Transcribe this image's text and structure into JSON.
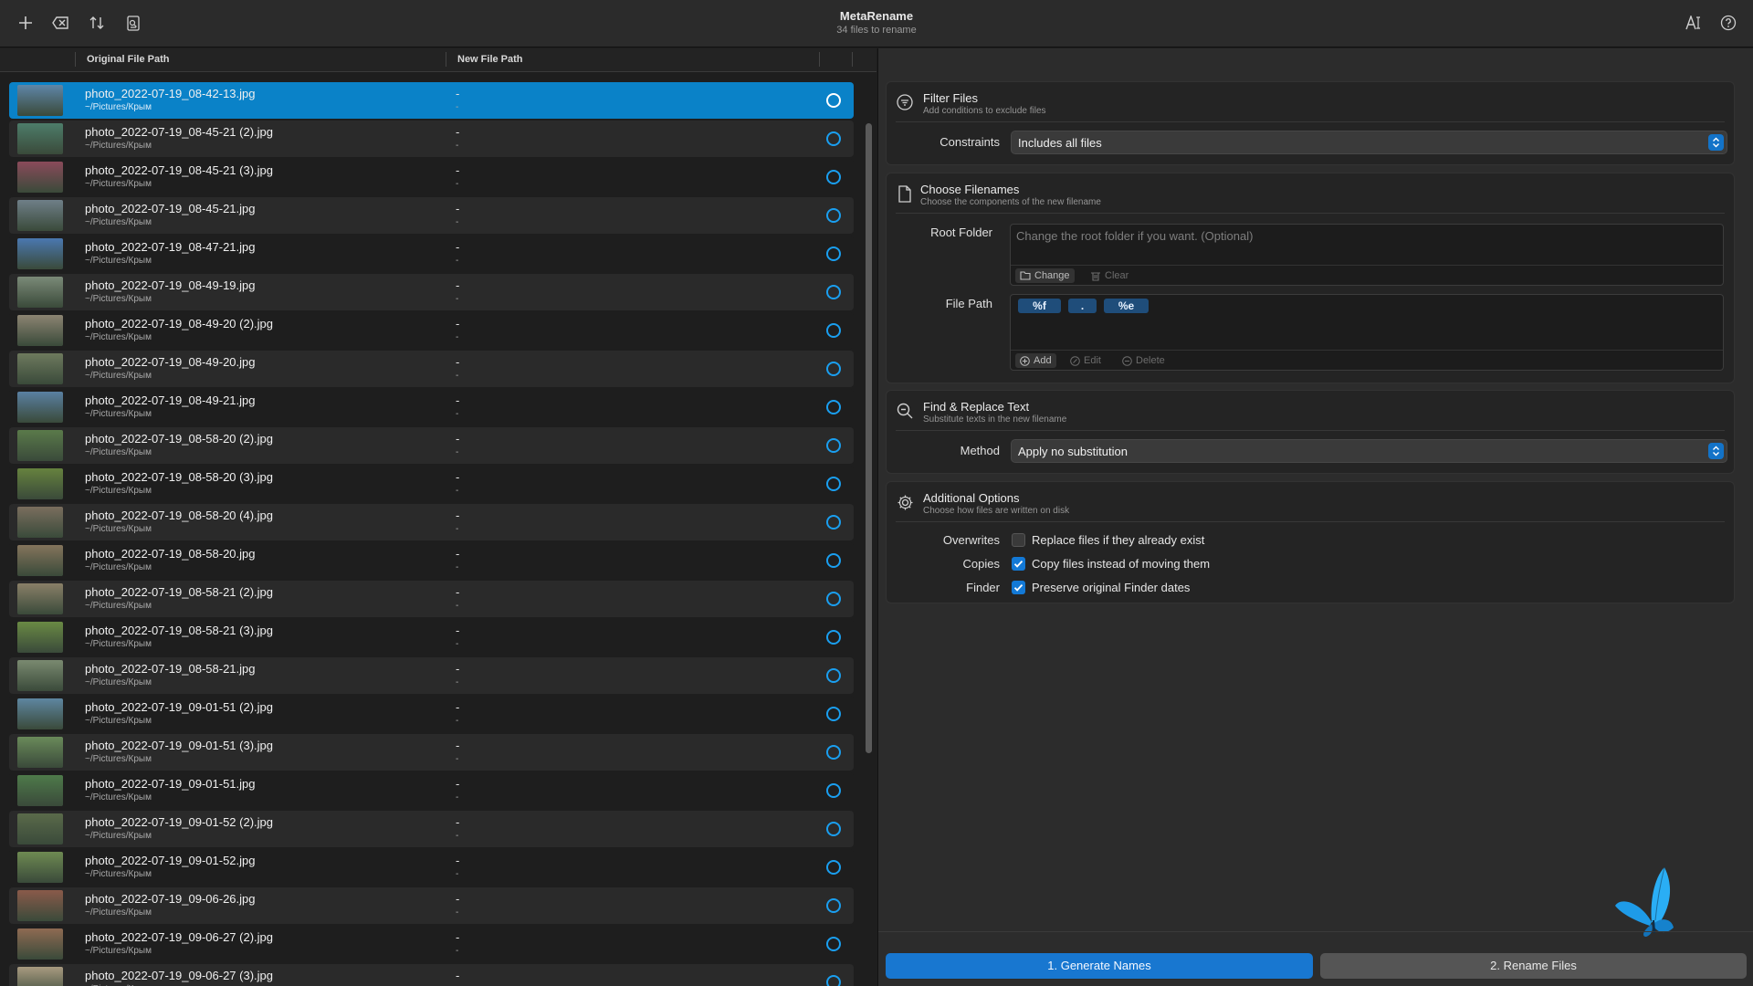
{
  "app": {
    "title": "MetaRename",
    "subtitle": "34 files to rename"
  },
  "toolbar": {
    "left_icons": [
      "plus-icon",
      "clear-icon",
      "sort-icon",
      "inspect-icon"
    ],
    "right_icons": [
      "text-format-icon",
      "help-icon"
    ]
  },
  "table": {
    "headers": [
      "Original File Path",
      "New File Path"
    ],
    "rows": [
      {
        "name": "photo_2022-07-19_08-42-13.jpg",
        "path": "~/Pictures/Крым",
        "new_name": "-",
        "new_path": "-",
        "thumb": "#5f86a8"
      },
      {
        "name": "photo_2022-07-19_08-45-21 (2).jpg",
        "path": "~/Pictures/Крым",
        "new_name": "-",
        "new_path": "-",
        "thumb": "#4d7d6a"
      },
      {
        "name": "photo_2022-07-19_08-45-21 (3).jpg",
        "path": "~/Pictures/Крым",
        "new_name": "-",
        "new_path": "-",
        "thumb": "#8a4a5a"
      },
      {
        "name": "photo_2022-07-19_08-45-21.jpg",
        "path": "~/Pictures/Крым",
        "new_name": "-",
        "new_path": "-",
        "thumb": "#6f7f88"
      },
      {
        "name": "photo_2022-07-19_08-47-21.jpg",
        "path": "~/Pictures/Крым",
        "new_name": "-",
        "new_path": "-",
        "thumb": "#4a78b0"
      },
      {
        "name": "photo_2022-07-19_08-49-19.jpg",
        "path": "~/Pictures/Крым",
        "new_name": "-",
        "new_path": "-",
        "thumb": "#7b8a78"
      },
      {
        "name": "photo_2022-07-19_08-49-20 (2).jpg",
        "path": "~/Pictures/Крым",
        "new_name": "-",
        "new_path": "-",
        "thumb": "#8c8472"
      },
      {
        "name": "photo_2022-07-19_08-49-20.jpg",
        "path": "~/Pictures/Крым",
        "new_name": "-",
        "new_path": "-",
        "thumb": "#6e7a5e"
      },
      {
        "name": "photo_2022-07-19_08-49-21.jpg",
        "path": "~/Pictures/Крым",
        "new_name": "-",
        "new_path": "-",
        "thumb": "#5a80a2"
      },
      {
        "name": "photo_2022-07-19_08-58-20 (2).jpg",
        "path": "~/Pictures/Крым",
        "new_name": "-",
        "new_path": "-",
        "thumb": "#5a7a4a"
      },
      {
        "name": "photo_2022-07-19_08-58-20 (3).jpg",
        "path": "~/Pictures/Крым",
        "new_name": "-",
        "new_path": "-",
        "thumb": "#66823e"
      },
      {
        "name": "photo_2022-07-19_08-58-20 (4).jpg",
        "path": "~/Pictures/Крым",
        "new_name": "-",
        "new_path": "-",
        "thumb": "#7a6e5e"
      },
      {
        "name": "photo_2022-07-19_08-58-20.jpg",
        "path": "~/Pictures/Крым",
        "new_name": "-",
        "new_path": "-",
        "thumb": "#84745c"
      },
      {
        "name": "photo_2022-07-19_08-58-21 (2).jpg",
        "path": "~/Pictures/Крым",
        "new_name": "-",
        "new_path": "-",
        "thumb": "#8a8068"
      },
      {
        "name": "photo_2022-07-19_08-58-21 (3).jpg",
        "path": "~/Pictures/Крым",
        "new_name": "-",
        "new_path": "-",
        "thumb": "#6a8a44"
      },
      {
        "name": "photo_2022-07-19_08-58-21.jpg",
        "path": "~/Pictures/Крым",
        "new_name": "-",
        "new_path": "-",
        "thumb": "#7a8a70"
      },
      {
        "name": "photo_2022-07-19_09-01-51 (2).jpg",
        "path": "~/Pictures/Крым",
        "new_name": "-",
        "new_path": "-",
        "thumb": "#5e86a0"
      },
      {
        "name": "photo_2022-07-19_09-01-51 (3).jpg",
        "path": "~/Pictures/Крым",
        "new_name": "-",
        "new_path": "-",
        "thumb": "#6a8a5a"
      },
      {
        "name": "photo_2022-07-19_09-01-51.jpg",
        "path": "~/Pictures/Крым",
        "new_name": "-",
        "new_path": "-",
        "thumb": "#4e7a4a"
      },
      {
        "name": "photo_2022-07-19_09-01-52 (2).jpg",
        "path": "~/Pictures/Крым",
        "new_name": "-",
        "new_path": "-",
        "thumb": "#5a6a4a"
      },
      {
        "name": "photo_2022-07-19_09-01-52.jpg",
        "path": "~/Pictures/Крым",
        "new_name": "-",
        "new_path": "-",
        "thumb": "#6e8a52"
      },
      {
        "name": "photo_2022-07-19_09-06-26.jpg",
        "path": "~/Pictures/Крым",
        "new_name": "-",
        "new_path": "-",
        "thumb": "#8a5a4a"
      },
      {
        "name": "photo_2022-07-19_09-06-27 (2).jpg",
        "path": "~/Pictures/Крым",
        "new_name": "-",
        "new_path": "-",
        "thumb": "#8e6a52"
      },
      {
        "name": "photo_2022-07-19_09-06-27 (3).jpg",
        "path": "~/Pictures/Крым",
        "new_name": "-",
        "new_path": "-",
        "thumb": "#a89a80"
      }
    ]
  },
  "filter": {
    "title": "Filter Files",
    "subtitle": "Add conditions to exclude files",
    "constraints_label": "Constraints",
    "constraints_value": "Includes all files"
  },
  "filenames": {
    "title": "Choose Filenames",
    "subtitle": "Choose the components of the new filename",
    "root_label": "Root Folder",
    "root_placeholder": "Change the root folder if you want. (Optional)",
    "change_label": "Change",
    "clear_label": "Clear",
    "path_label": "File Path",
    "tokens": [
      "%f",
      ".",
      "%e"
    ],
    "add_label": "Add",
    "edit_label": "Edit",
    "delete_label": "Delete"
  },
  "replace": {
    "title": "Find & Replace Text",
    "subtitle": "Substitute texts in the new filename",
    "method_label": "Method",
    "method_value": "Apply no substitution"
  },
  "options": {
    "title": "Additional Options",
    "subtitle": "Choose how files are written on disk",
    "items": [
      {
        "label": "Overwrites",
        "text": "Replace files if they already exist",
        "checked": false
      },
      {
        "label": "Copies",
        "text": "Copy files instead of moving them",
        "checked": true
      },
      {
        "label": "Finder",
        "text": "Preserve original Finder dates",
        "checked": true
      }
    ]
  },
  "actions": {
    "generate": "1. Generate Names",
    "rename": "2. Rename Files"
  },
  "colors": {
    "accent": "#0a82c8",
    "primary_button": "#1877d0",
    "status_ring": "#1a9ff0",
    "butterfly": "#1e9be8"
  }
}
